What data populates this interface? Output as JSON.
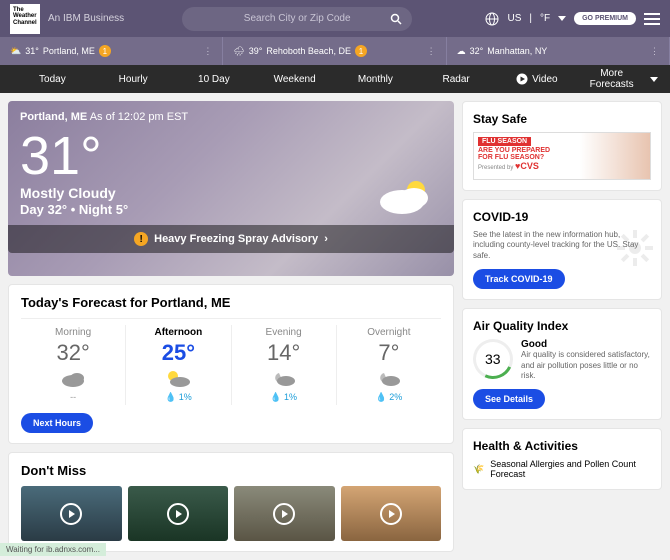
{
  "header": {
    "logo_text": "The\nWeather\nChannel",
    "tagline": "An IBM Business",
    "search_placeholder": "Search City or Zip Code",
    "country": "US",
    "unit": "°F",
    "premium": "GO PREMIUM"
  },
  "locations": [
    {
      "temp": "31°",
      "name": "Portland, ME",
      "alerts": "1"
    },
    {
      "temp": "39°",
      "name": "Rehoboth Beach, DE",
      "alerts": "1"
    },
    {
      "temp": "32°",
      "name": "Manhattan, NY",
      "alerts": ""
    }
  ],
  "nav": {
    "today": "Today",
    "hourly": "Hourly",
    "tenday": "10 Day",
    "weekend": "Weekend",
    "monthly": "Monthly",
    "radar": "Radar",
    "video": "Video",
    "more": "More Forecasts"
  },
  "hero": {
    "city": "Portland, ME",
    "asof": "As of 12:02 pm EST",
    "temp": "31°",
    "cond": "Mostly Cloudy",
    "hilo": "Day 32° • Night 5°",
    "advisory": "Heavy Freezing Spray Advisory"
  },
  "forecast": {
    "title": "Today's Forecast for Portland, ME",
    "parts": [
      {
        "label": "Morning",
        "temp": "32°",
        "precip": "--"
      },
      {
        "label": "Afternoon",
        "temp": "25°",
        "precip": "1%"
      },
      {
        "label": "Evening",
        "temp": "14°",
        "precip": "1%"
      },
      {
        "label": "Overnight",
        "temp": "7°",
        "precip": "2%"
      }
    ],
    "btn": "Next Hours"
  },
  "dontmiss": {
    "title": "Don't Miss"
  },
  "staysafe": {
    "title": "Stay Safe",
    "tag": "FLU SEASON",
    "q": "ARE YOU PREPARED\nFOR FLU SEASON?",
    "pres": "Presented by",
    "cvs": "♥CVS"
  },
  "covid": {
    "title": "COVID-19",
    "body": "See the latest in the new information hub, including county-level tracking for the US. Stay safe.",
    "btn": "Track COVID-19"
  },
  "aqi": {
    "title": "Air Quality Index",
    "value": "33",
    "rating": "Good",
    "body": "Air quality is considered satisfactory, and air pollution poses little or no risk.",
    "btn": "See Details"
  },
  "health": {
    "title": "Health & Activities",
    "sub": "Seasonal Allergies and Pollen Count Forecast"
  },
  "status": "Waiting for ib.adnxs.com..."
}
